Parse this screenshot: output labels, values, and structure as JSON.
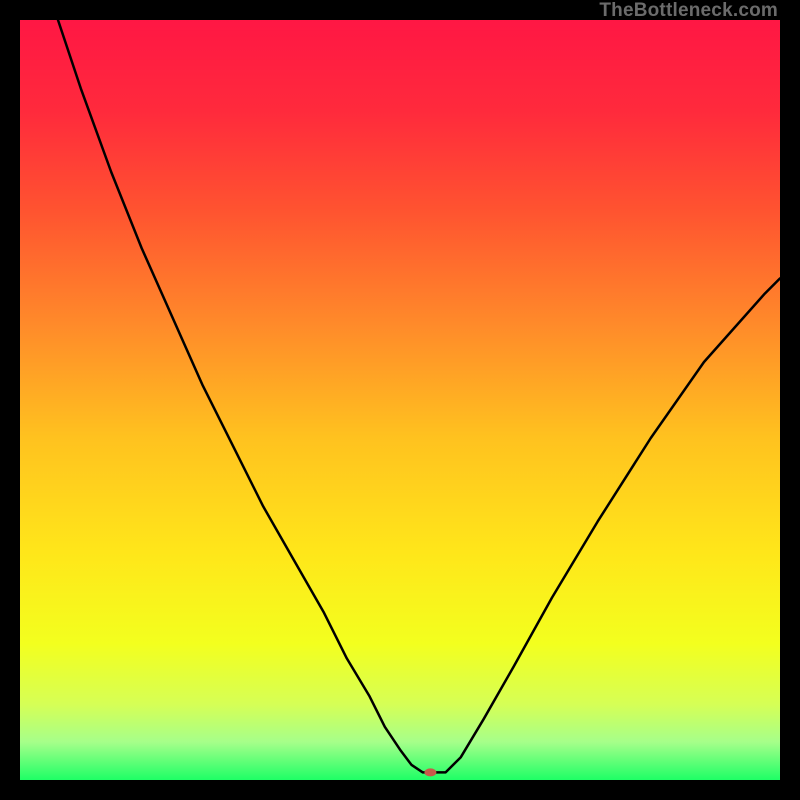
{
  "watermark": "TheBottleneck.com",
  "chart_data": {
    "type": "line",
    "title": "",
    "xlabel": "",
    "ylabel": "",
    "xlim": [
      0,
      100
    ],
    "ylim": [
      0,
      100
    ],
    "grid": false,
    "legend": false,
    "background_gradient": {
      "stops": [
        {
          "offset": 0.0,
          "color": "#ff1744"
        },
        {
          "offset": 0.12,
          "color": "#ff2a3c"
        },
        {
          "offset": 0.25,
          "color": "#ff5330"
        },
        {
          "offset": 0.4,
          "color": "#ff8a2a"
        },
        {
          "offset": 0.55,
          "color": "#ffc21f"
        },
        {
          "offset": 0.7,
          "color": "#ffe61a"
        },
        {
          "offset": 0.82,
          "color": "#f3ff1e"
        },
        {
          "offset": 0.9,
          "color": "#d6ff55"
        },
        {
          "offset": 0.95,
          "color": "#a6ff8a"
        },
        {
          "offset": 1.0,
          "color": "#1eff66"
        }
      ]
    },
    "series": [
      {
        "name": "bottleneck-curve",
        "color": "#000000",
        "x": [
          5,
          8,
          12,
          16,
          20,
          24,
          28,
          32,
          36,
          40,
          43,
          46,
          48,
          50,
          51.5,
          53,
          54,
          56,
          58,
          61,
          65,
          70,
          76,
          83,
          90,
          98,
          100
        ],
        "y": [
          100,
          91,
          80,
          70,
          61,
          52,
          44,
          36,
          29,
          22,
          16,
          11,
          7,
          4,
          2,
          1,
          1,
          1,
          3,
          8,
          15,
          24,
          34,
          45,
          55,
          64,
          66
        ]
      }
    ],
    "marker": {
      "name": "current-point",
      "x": 54,
      "y": 1,
      "color": "#c85a4a",
      "rx": 6,
      "ry": 4
    }
  }
}
